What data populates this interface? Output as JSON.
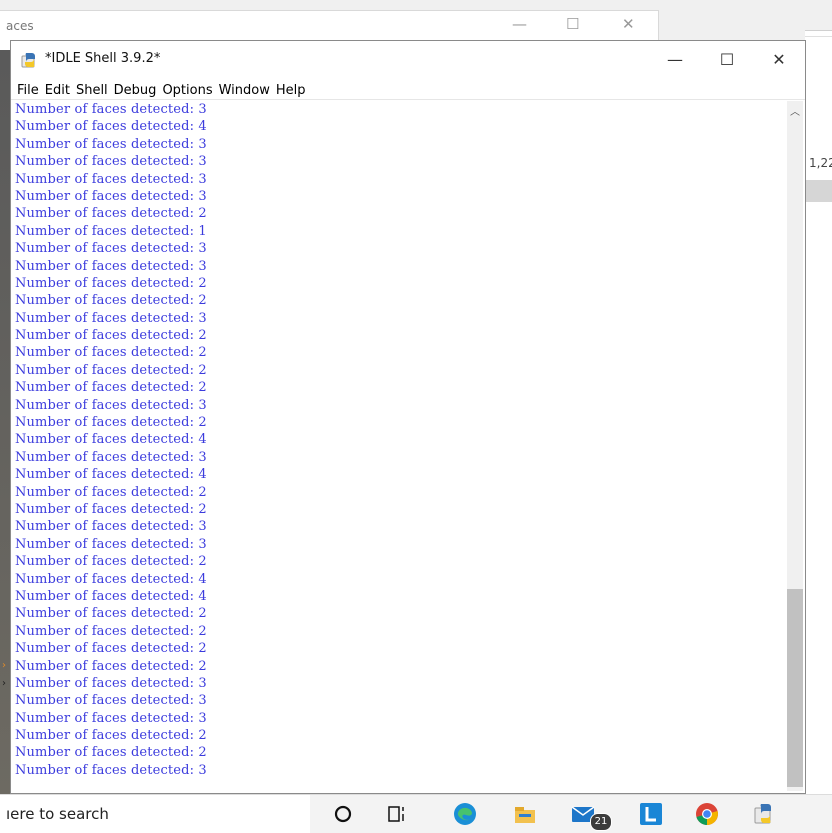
{
  "background_window": {
    "title": "aces"
  },
  "right_window": {
    "text": "1,22"
  },
  "window": {
    "title": "*IDLE Shell 3.9.2*"
  },
  "menu": [
    "File",
    "Edit",
    "Shell",
    "Debug",
    "Options",
    "Window",
    "Help"
  ],
  "shell": {
    "lines": [
      "Number of faces detected: 3",
      "Number of faces detected: 4",
      "Number of faces detected: 3",
      "Number of faces detected: 3",
      "Number of faces detected: 3",
      "Number of faces detected: 3",
      "Number of faces detected: 2",
      "Number of faces detected: 1",
      "Number of faces detected: 3",
      "Number of faces detected: 3",
      "Number of faces detected: 2",
      "Number of faces detected: 2",
      "Number of faces detected: 3",
      "Number of faces detected: 2",
      "Number of faces detected: 2",
      "Number of faces detected: 2",
      "Number of faces detected: 2",
      "Number of faces detected: 3",
      "Number of faces detected: 2",
      "Number of faces detected: 4",
      "Number of faces detected: 3",
      "Number of faces detected: 4",
      "Number of faces detected: 2",
      "Number of faces detected: 2",
      "Number of faces detected: 3",
      "Number of faces detected: 3",
      "Number of faces detected: 2",
      "Number of faces detected: 4",
      "Number of faces detected: 4",
      "Number of faces detected: 2",
      "Number of faces detected: 2",
      "Number of faces detected: 2",
      "Number of faces detected: 2",
      "Number of faces detected: 3",
      "Number of faces detected: 3",
      "Number of faces detected: 3",
      "Number of faces detected: 2",
      "Number of faces detected: 2",
      "Number of faces detected: 3"
    ],
    "text_color": "#3b3bdd"
  },
  "taskbar": {
    "search_text": "ıere to search",
    "mail_badge": "21",
    "icons": [
      "cortana-icon",
      "task-view-icon",
      "edge-icon",
      "file-explorer-icon",
      "mail-icon",
      "launcher-l-icon",
      "chrome-icon",
      "python-idle-icon"
    ]
  }
}
